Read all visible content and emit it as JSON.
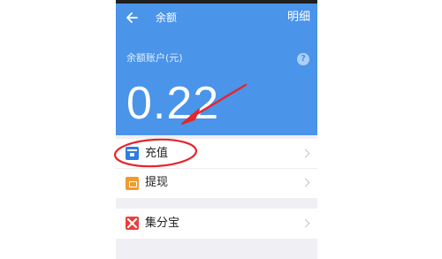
{
  "nav": {
    "back_icon": "arrow-left-icon",
    "title": "余额",
    "detail_label": "明细"
  },
  "balance": {
    "account_label": "余额账户(元)",
    "help_icon": "question-icon",
    "help_glyph": "?",
    "amount": "0.22"
  },
  "menu": {
    "recharge": {
      "label": "充值",
      "icon": "card-icon"
    },
    "withdraw": {
      "label": "提现",
      "icon": "wallet-icon"
    },
    "jifenbao": {
      "label": "集分宝",
      "icon": "jifenbao-icon"
    }
  },
  "colors": {
    "header": "#4a94ea",
    "annotation": "#e5262b",
    "recharge_icon": "#2e7de0",
    "withdraw_icon": "#f29b2e",
    "jifenbao_icon": "#e8403f"
  }
}
